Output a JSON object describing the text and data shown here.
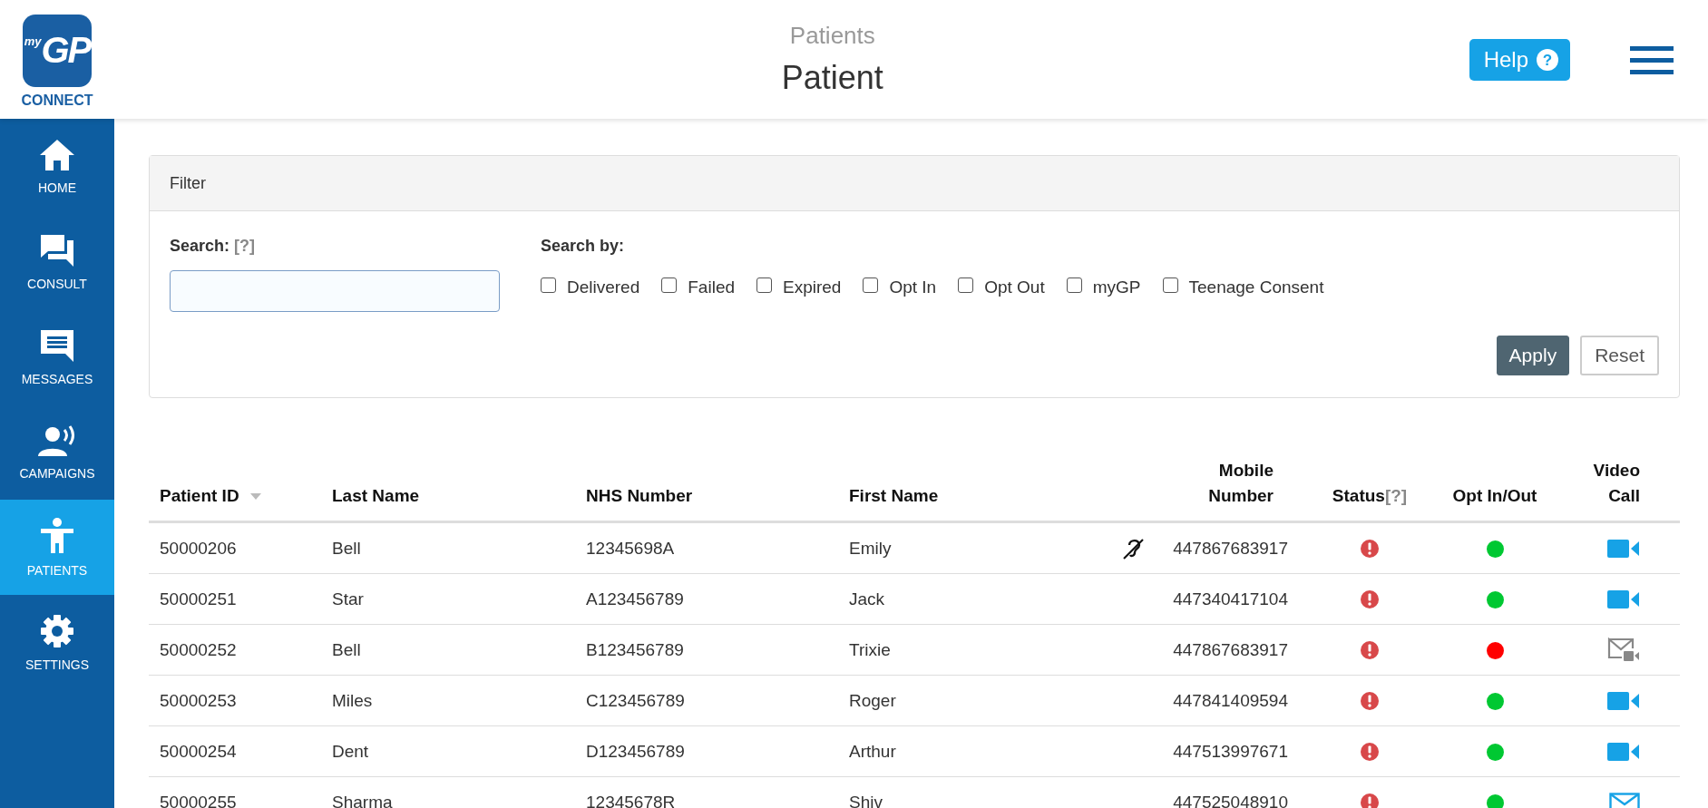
{
  "logo": {
    "small": "my",
    "big": "GP",
    "caption": "CONNECT"
  },
  "header": {
    "section": "Patients",
    "title": "Patient",
    "help": "Help",
    "help_icon": "?"
  },
  "sidebar": {
    "items": [
      {
        "label": "HOME",
        "kind": "home",
        "selected": false
      },
      {
        "label": "CONSULT",
        "kind": "consult",
        "selected": false
      },
      {
        "label": "MESSAGES",
        "kind": "messages",
        "selected": false
      },
      {
        "label": "CAMPAIGNS",
        "kind": "campaigns",
        "selected": false
      },
      {
        "label": "PATIENTS",
        "kind": "patients",
        "selected": true
      },
      {
        "label": "SETTINGS",
        "kind": "settings",
        "selected": false
      }
    ]
  },
  "filter": {
    "title": "Filter",
    "search_label": "Search:",
    "search_hint": "[?]",
    "search_by_label": "Search by:",
    "options": [
      {
        "label": "Delivered",
        "checked": false
      },
      {
        "label": "Failed",
        "checked": false
      },
      {
        "label": "Expired",
        "checked": false
      },
      {
        "label": "Opt In",
        "checked": false
      },
      {
        "label": "Opt Out",
        "checked": false
      },
      {
        "label": "myGP",
        "checked": false
      },
      {
        "label": "Teenage Consent",
        "checked": false
      }
    ],
    "apply": "Apply",
    "reset": "Reset"
  },
  "table": {
    "columns": [
      {
        "label": "Patient ID",
        "sorted": true
      },
      {
        "label": "Last Name",
        "sorted": false
      },
      {
        "label": "NHS Number",
        "sorted": false
      },
      {
        "label": "First Name",
        "sorted": false
      },
      {
        "label": "Mobile Number",
        "sorted": false
      },
      {
        "label": "Status",
        "hint": "[?]",
        "sorted": false
      },
      {
        "label": "Opt In/Out",
        "sorted": false
      },
      {
        "label": "Video Call",
        "sorted": false
      }
    ],
    "rows": [
      {
        "id": "50000206",
        "last": "Bell",
        "nhs": "12345698A",
        "first": "Emily",
        "hearing_loop": true,
        "mobile": "447867683917",
        "color": "#00c832",
        "kind": "video"
      },
      {
        "id": "50000251",
        "last": "Star",
        "nhs": "A123456789",
        "first": "Jack",
        "hearing_loop": false,
        "mobile": "447340417104",
        "color": "#00c832",
        "kind": "video"
      },
      {
        "id": "50000252",
        "last": "Bell",
        "nhs": "B123456789",
        "first": "Trixie",
        "hearing_loop": false,
        "mobile": "447867683917",
        "color": "#ff0000",
        "kind": "unavailable"
      },
      {
        "id": "50000253",
        "last": "Miles",
        "nhs": "C123456789",
        "first": "Roger",
        "hearing_loop": false,
        "mobile": "447841409594",
        "color": "#00c832",
        "kind": "video"
      },
      {
        "id": "50000254",
        "last": "Dent",
        "nhs": "D123456789",
        "first": "Arthur",
        "hearing_loop": false,
        "mobile": "447513997671",
        "color": "#00c832",
        "kind": "video"
      },
      {
        "id": "50000255",
        "last": "Sharma",
        "nhs": "12345678R",
        "first": "Shiv",
        "hearing_loop": false,
        "mobile": "447525048910",
        "color": "#00c832",
        "kind": "email"
      }
    ]
  }
}
